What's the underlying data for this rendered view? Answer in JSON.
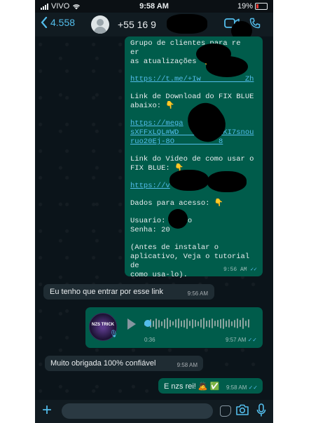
{
  "status_bar": {
    "carrier": "VIVO",
    "time": "9:58 AM",
    "battery": "19%"
  },
  "header": {
    "back_count": "4.558",
    "contact_name": "+55 16 9"
  },
  "messages": {
    "big_block": {
      "lines": [
        "Grupo de clientes para re  er\nas atualizações 👇",
        "https://t.me/+Iw          Zh",
        "Link de Download do FIX BLUE\nabaixo: 👇",
        "https://mega\nsXFFxLQL#WD          KI7snou\nruo20Ej-8O          8",
        "Link do Video de como usar o\nFIX BLUE: 👇",
        "https://v",
        "Dados para acesso: 👇",
        "Usuario:     o\nSenha: 20",
        "(Antes de instalar o\naplicativo, Veja o tutorial de\ncomo usa-lo)."
      ],
      "time": "9:56 AM",
      "ticks": "✓✓"
    },
    "m1": {
      "text": "Eu tenho que entrar por esse link",
      "time": "9:56 AM"
    },
    "voice": {
      "avatar_text": "NZS TRICK",
      "duration": "0:36",
      "time": "9:57 AM",
      "ticks": "✓✓"
    },
    "m2": {
      "text": "Muito obrigada 100% confiável",
      "time": "9:58 AM"
    },
    "m3": {
      "text": "E nzs rei! 🙇 ✅",
      "time": "9:58 AM",
      "ticks": "✓✓"
    }
  },
  "icons": {
    "back": "chevron-left-icon",
    "video": "video-call-icon",
    "call": "phone-icon",
    "plus": "plus-icon",
    "sticker": "sticker-icon",
    "camera": "camera-icon",
    "mic": "microphone-icon"
  },
  "colors": {
    "outgoing": "#005c4b",
    "incoming": "#1f2c33",
    "link": "#53bdeb",
    "background": "#0b141a"
  }
}
